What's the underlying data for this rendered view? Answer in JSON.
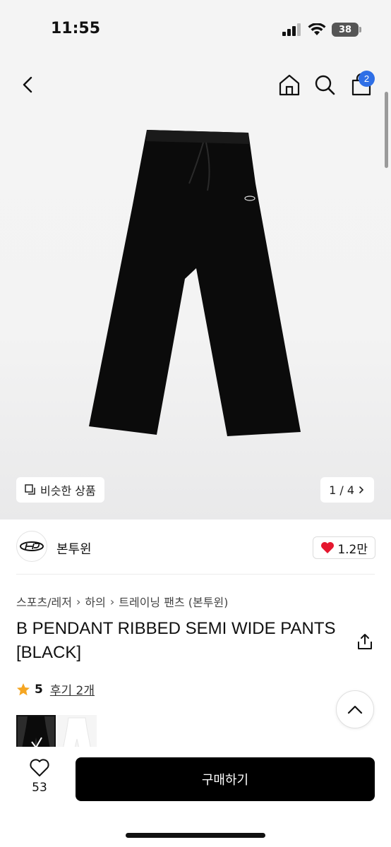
{
  "status_bar": {
    "time": "11:55",
    "battery": "38"
  },
  "nav": {
    "back_icon": "chevron-left-icon",
    "home_icon": "home-icon",
    "search_icon": "search-icon",
    "bag_icon": "shopping-bag-icon",
    "bag_count": "2"
  },
  "gallery": {
    "similar_label": "비슷한 상품",
    "page_indicator": "1 / 4"
  },
  "brand": {
    "name": "본투윈",
    "likes": "1.2만"
  },
  "breadcrumb": [
    "스포츠/레저",
    "하의",
    "트레이닝 팬츠 (본투윈)"
  ],
  "product": {
    "title": "B PENDANT RIBBED SEMI WIDE PANTS [BLACK]",
    "rating": "5",
    "reviews": "후기 2개"
  },
  "bottom_bar": {
    "wish_count": "53",
    "buy_label": "구매하기"
  },
  "colors": {
    "accent": "#2f6fe6",
    "heart": "#e5172f",
    "star": "#f5a623",
    "buy_button": "#000000"
  }
}
